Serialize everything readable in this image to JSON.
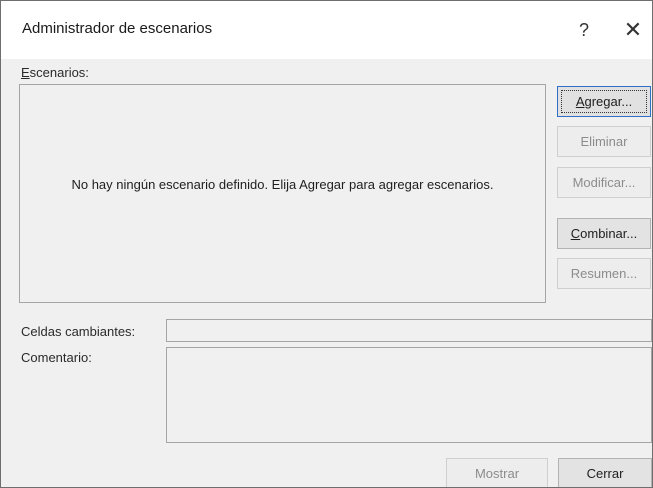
{
  "window": {
    "title": "Administrador de escenarios",
    "help_glyph": "?",
    "close_glyph": "✕"
  },
  "scenarios": {
    "label_accel": "E",
    "label_rest": "scenarios:",
    "empty_message": "No hay ningún escenario definido. Elija Agregar para agregar escenarios."
  },
  "buttons": {
    "add_accel": "A",
    "add_rest": "gregar...",
    "delete": "Eliminar",
    "modify": "Modificar...",
    "merge_accel": "C",
    "merge_rest": "ombinar...",
    "summary": "Resumen...",
    "show": "Mostrar",
    "close": "Cerrar"
  },
  "fields": {
    "changing_cells_label": "Celdas cambiantes:",
    "changing_cells_value": "",
    "comment_label": "Comentario:",
    "comment_value": ""
  }
}
